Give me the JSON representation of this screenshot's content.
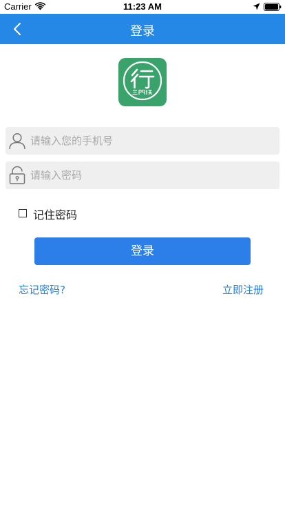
{
  "status_bar": {
    "carrier": "Carrier",
    "time": "11:23 AM",
    "icons": [
      "wifi-icon",
      "location-icon",
      "battery-icon"
    ]
  },
  "nav": {
    "title": "登录",
    "back_icon": "chevron-left-icon"
  },
  "logo": {
    "glyph": "行",
    "caption": "三門峽",
    "color": "#3aa36b"
  },
  "form": {
    "phone_placeholder": "请输入您的手机号",
    "phone_value": "",
    "phone_icon": "user-icon",
    "password_placeholder": "请输入密码",
    "password_value": "",
    "password_icon": "lock-icon"
  },
  "remember": {
    "label": "记住密码",
    "checked": false
  },
  "login_button": {
    "label": "登录"
  },
  "links": {
    "forgot": "忘记密码?",
    "register": "立即注册"
  },
  "colors": {
    "accent": "#2587e6",
    "button": "#2c7fe8",
    "link": "#2a7fd8",
    "input_bg": "#efefef"
  }
}
